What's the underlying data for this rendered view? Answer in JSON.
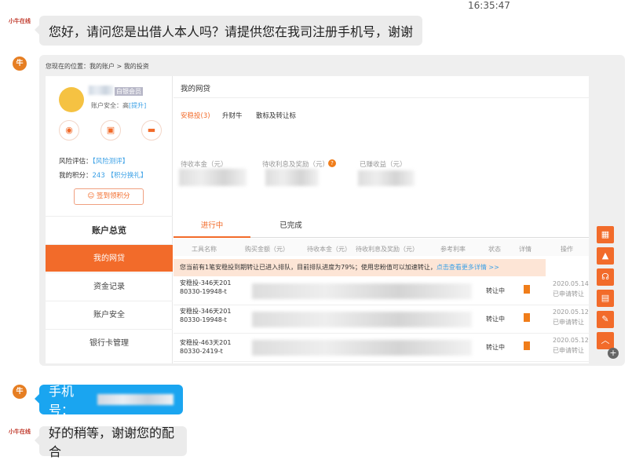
{
  "chat": {
    "timestamp": "16:35:47",
    "agent_logo_text": "小牛在线",
    "user_avatar_text": "牛",
    "msg1": "您好，请问您是出借人本人吗？请提供您在我司注册手机号，谢谢",
    "msg2_label": "手机号：",
    "msg3": "好的稍等，谢谢您的配合"
  },
  "screenshot": {
    "breadcrumb": "您现在的位置：我的账户 > 我的投资",
    "member_badge": "白银会员",
    "security_label": "账户安全：",
    "security_level": "高",
    "security_upgrade": "[提升]",
    "risk_label": "风险评估：",
    "risk_link": "【风险测评】",
    "points_label": "我的积分：",
    "points_value": "243",
    "points_link": "【积分换礼】",
    "signin_button": "签到领积分",
    "nav_title": "账户总览",
    "nav": [
      "我的网贷",
      "资金记录",
      "账户安全",
      "银行卡管理"
    ],
    "section_title": "我的网贷",
    "product_tabs": [
      "安稳投(3)",
      "升财牛",
      "散标及转让标"
    ],
    "stats": [
      "待收本金（元）",
      "待收利息及奖励（元）",
      "已赚收益（元）"
    ],
    "status_tabs": [
      "进行中",
      "已完成"
    ],
    "columns": [
      "工具名称",
      "购买金额（元）",
      "待收本金（元）",
      "待收利息及奖励（元）",
      "参考利率",
      "状态",
      "详情",
      "操作"
    ],
    "notice": "您当前有1笔安稳投到期转让已进入排队，目前排队进度为79%；使用忠粉值可以加速转让，",
    "notice_link": "点击查看更多详情 >>",
    "rows": [
      {
        "name": "安稳投-346天20180330-19948-t",
        "status": "转让中",
        "date": "2020.05.14",
        "op": "已申请转让"
      },
      {
        "name": "安稳投-346天20180330-19948-t",
        "status": "转让中",
        "date": "2020.05.12",
        "op": "已申请转让"
      },
      {
        "name": "安稳投-463天20180330-2419-t",
        "status": "转让中",
        "date": "2020.05.12",
        "op": "已申请转让"
      }
    ]
  },
  "colors": {
    "accent": "#f26b2a",
    "bubble_blue": "#1aa5f0",
    "link": "#3aa0e6"
  }
}
